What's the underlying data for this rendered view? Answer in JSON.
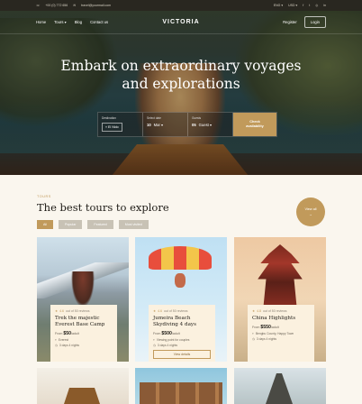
{
  "topbar": {
    "phone": "+00 (0) 772 656",
    "email": "travel@yourmail.com",
    "language": "ENG",
    "currency": "USD"
  },
  "nav": {
    "links": [
      "Home",
      "Tours ▾",
      "Blog",
      "Contact us"
    ],
    "logo": "VICTORIA",
    "register": "Register",
    "login": "Login"
  },
  "hero": {
    "line1": "Embark on extraordinary voyages",
    "line2": "and explorations"
  },
  "search": {
    "dest_label": "Destination",
    "dest_value": "El Nido",
    "date_label": "Select date",
    "date_day": "10",
    "date_month": "Mar ▾",
    "guests_label": "Guests",
    "guests_count": "05",
    "guests_unit": "Guest ▾",
    "check_line1": "Check",
    "check_line2": "availability"
  },
  "tours": {
    "kicker": "TOURS",
    "title": "The best tours to explore",
    "filters": [
      "All",
      "Popular",
      "Featured",
      "Most visited"
    ],
    "view_all": "View all"
  },
  "cards": [
    {
      "rating": "4.6",
      "reviews": "out of 50 reviews",
      "title": "Trek the majestic Everest Base Camp",
      "from": "From",
      "price": "$50",
      "unit": "/adult",
      "loc": "Everest",
      "dur": "3 days 4 nights"
    },
    {
      "rating": "4.6",
      "reviews": "out of 50 reviews",
      "title": "Jumeira Beach Skydiving 4 days",
      "from": "From",
      "price": "$500",
      "unit": "/adult",
      "loc": "Viewing point for couples",
      "dur": "3 days 4 nights",
      "btn": "View details"
    },
    {
      "rating": "4.8",
      "reviews": "out of 50 reviews",
      "title": "China Highlights",
      "from": "From",
      "price": "$550",
      "unit": "/adult",
      "loc": "Bengbu County, Happy Town",
      "dur": "3 days 4 nights"
    }
  ],
  "colors": {
    "accent": "#c19a5b",
    "bg": "#faf6ee"
  }
}
